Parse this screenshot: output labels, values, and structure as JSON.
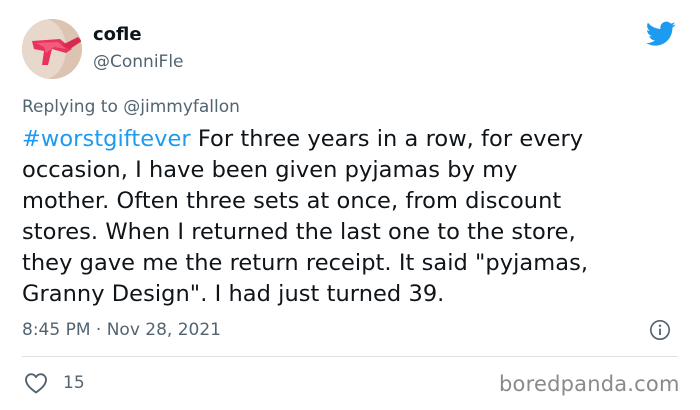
{
  "user": {
    "display_name": "cofle",
    "handle": "@ConniFle"
  },
  "reply": {
    "prefix": "Replying to ",
    "mention": "@jimmyfallon"
  },
  "tweet": {
    "hashtag": "#worstgiftever",
    "line1_rest": " For three years in a row, for every",
    "line2": "occasion, I have been given pyjamas by my",
    "line3": "mother. Often three sets at once, from discount",
    "line4": "stores. When I returned the last one to the store,",
    "line5": "they gave me the return receipt. It said \"pyjamas,",
    "line6": "Granny Design\". I had just turned 39."
  },
  "meta": {
    "timestamp": "8:45 PM · Nov 28, 2021"
  },
  "engagement": {
    "likes": "15"
  },
  "watermark": "boredpanda.com",
  "colors": {
    "link_blue": "#1d9bf0",
    "secondary_text": "#536471",
    "primary_text": "#0f1419"
  },
  "icons": {
    "bird": "twitter-bird-icon",
    "info": "info-icon",
    "like": "heart-icon"
  }
}
